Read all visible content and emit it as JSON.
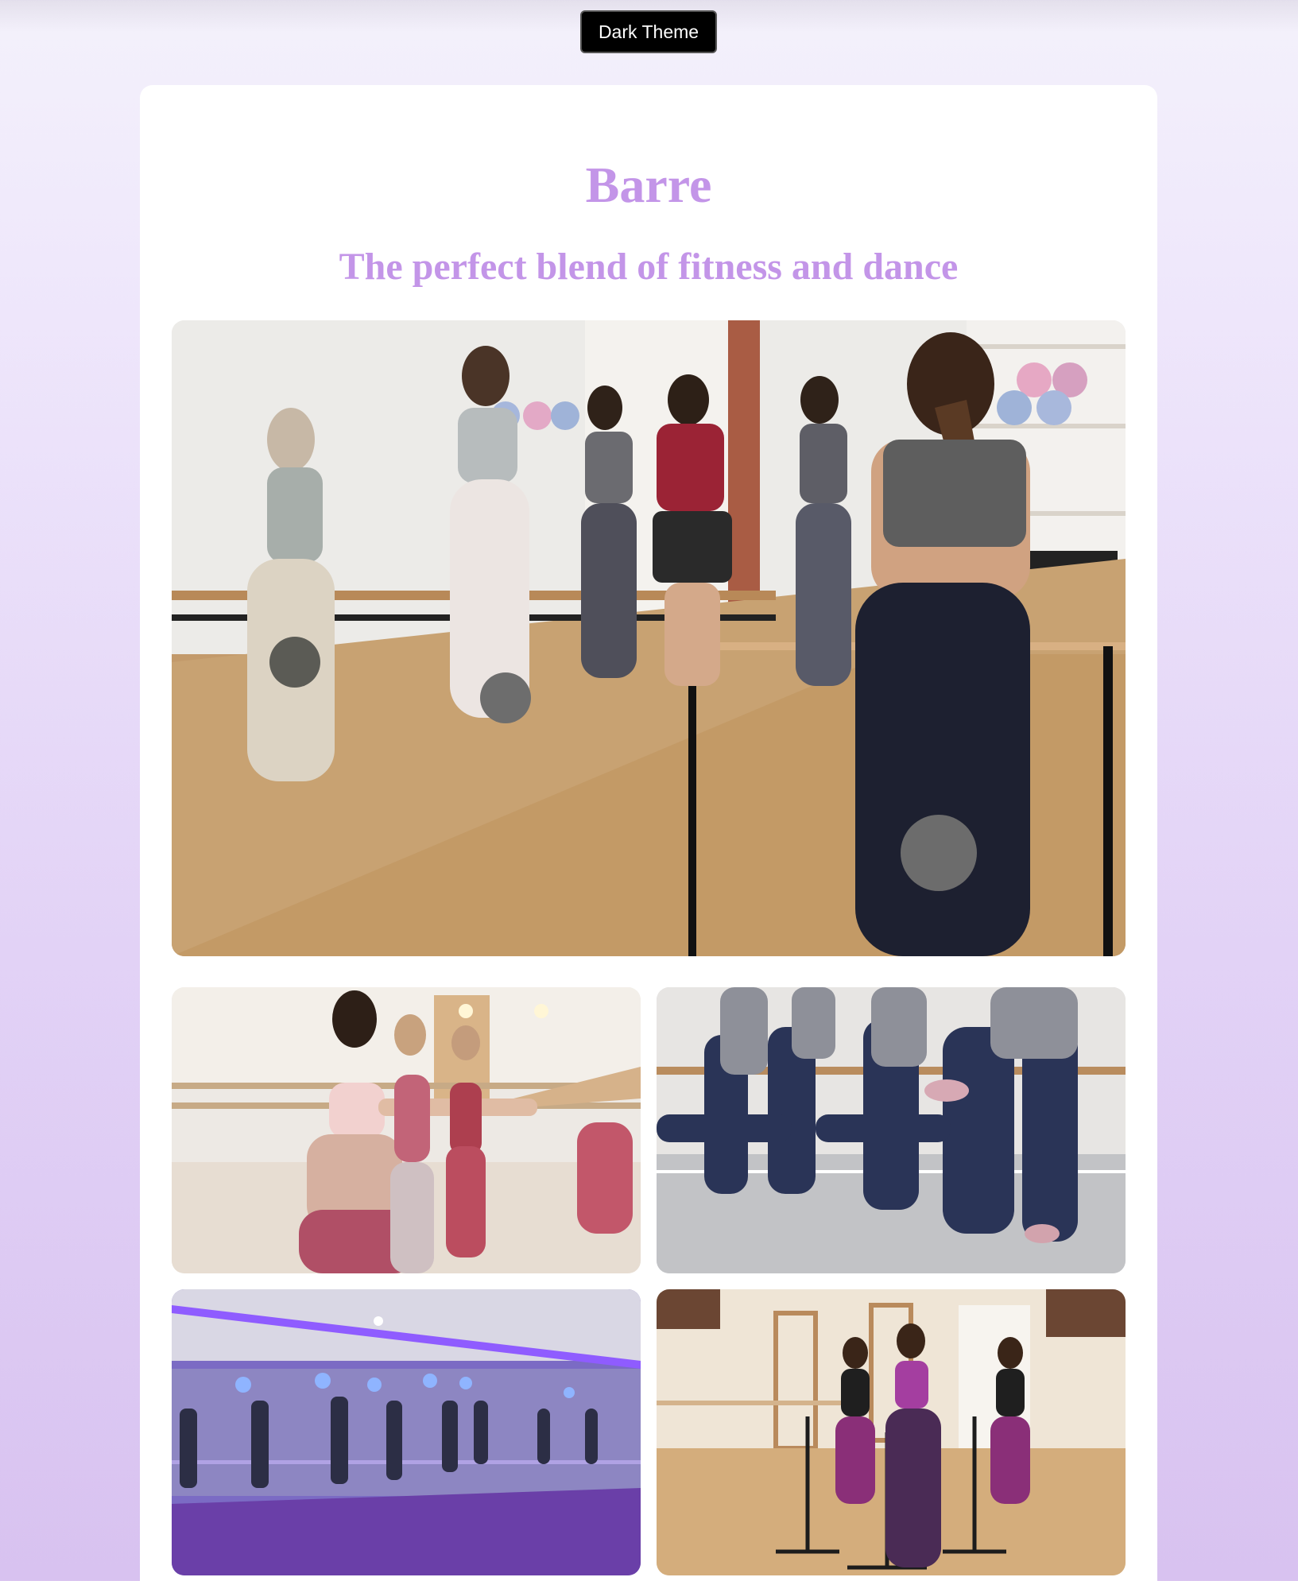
{
  "theme_toggle": {
    "label": "Dark Theme"
  },
  "header": {
    "title": "Barre",
    "subtitle": "The perfect blend of fitness and dance"
  },
  "colors": {
    "heading": "#c395e8",
    "button_bg": "#000000",
    "card_bg": "#ffffff"
  },
  "gallery": [
    {
      "description": "group barre class in bright studio with mirrors and wooden floor"
    },
    {
      "description": "woman holding barre in plie squat"
    },
    {
      "description": "dancers in navy leggings doing leg lifts at barre"
    },
    {
      "description": "barre class in purple lit studio"
    },
    {
      "description": "three women at portable barres in studio"
    }
  ]
}
